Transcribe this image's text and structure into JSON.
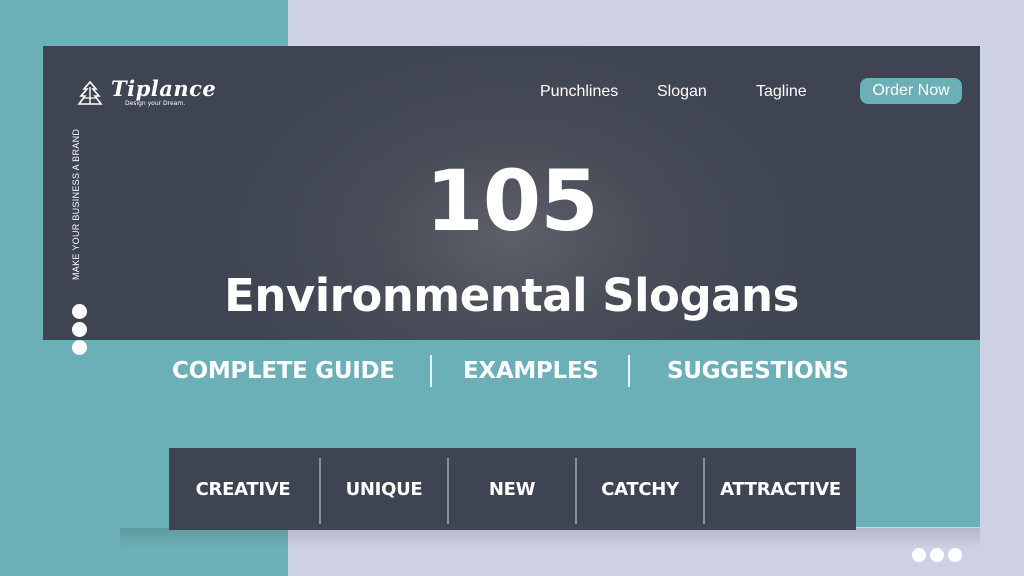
{
  "brand": {
    "name": "Tiplance",
    "tagline": "Design your Dream."
  },
  "nav": {
    "items": [
      "Punchlines",
      "Slogan",
      "Tagline"
    ],
    "cta": "Order Now"
  },
  "side_text": "MAKE YOUR BUSINESS A BRAND",
  "hero": {
    "number": "105",
    "headline": "Environmental Slogans"
  },
  "subtitles": [
    "COMPLETE GUIDE",
    "EXAMPLES",
    "SUGGESTIONS"
  ],
  "features": [
    "CREATIVE",
    "UNIQUE",
    "NEW",
    "CATCHY",
    "ATTRACTIVE"
  ],
  "colors": {
    "teal": "#6bb0b6",
    "dark": "#3f4453",
    "lavender": "#cdd1e3",
    "white": "#ffffff"
  },
  "icons": [
    "tiplance-logo-icon"
  ]
}
